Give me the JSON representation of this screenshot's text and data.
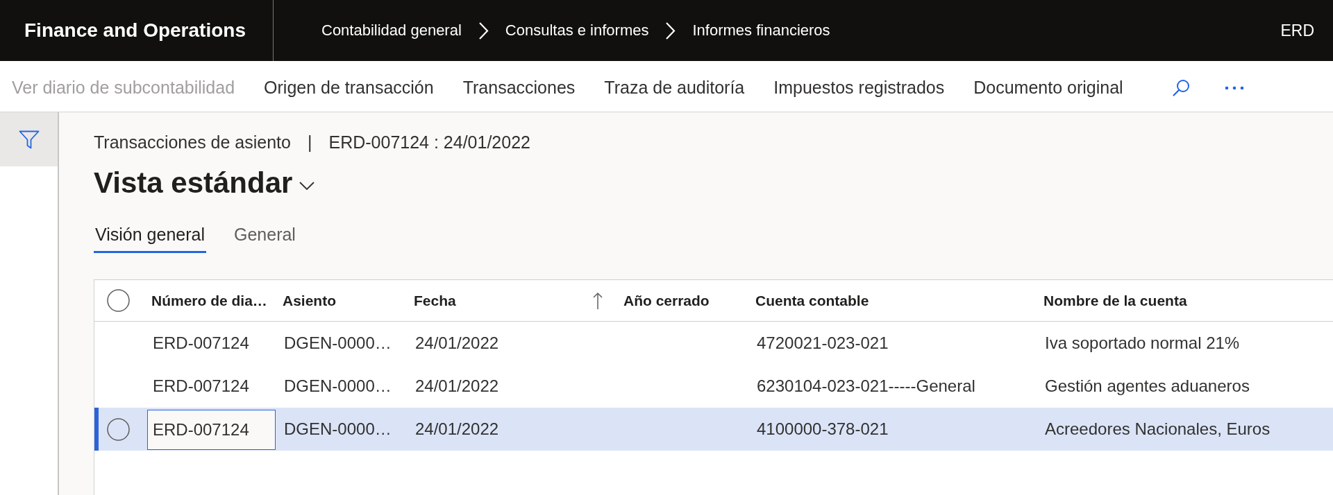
{
  "top_bar": {
    "app_title": "Finance and Operations",
    "breadcrumb": [
      "Contabilidad general",
      "Consultas e informes",
      "Informes financieros"
    ],
    "company": "ERD"
  },
  "action_bar": {
    "items": [
      {
        "label": "Ver diario de subcontabilidad",
        "disabled": true
      },
      {
        "label": "Origen de transacción",
        "disabled": false
      },
      {
        "label": "Transacciones",
        "disabled": false
      },
      {
        "label": "Traza de auditoría",
        "disabled": false
      },
      {
        "label": "Impuestos registrados",
        "disabled": false
      },
      {
        "label": "Documento original",
        "disabled": false
      }
    ]
  },
  "page": {
    "caption": "Transacciones de asiento",
    "separator": "|",
    "record": "ERD-007124 : 24/01/2022",
    "view": "Vista estándar"
  },
  "tabs": [
    {
      "label": "Visión general",
      "selected": true
    },
    {
      "label": "General",
      "selected": false
    }
  ],
  "grid": {
    "select_all": {
      "checked": false
    },
    "columns": [
      {
        "label": "Número de dia…",
        "sorted": false
      },
      {
        "label": "Asiento",
        "sorted": false
      },
      {
        "label": "Fecha",
        "sorted": true
      },
      {
        "label": "Año cerrado",
        "sorted": false
      },
      {
        "label": "Cuenta contable",
        "sorted": false
      },
      {
        "label": "Nombre de la cuenta",
        "sorted": false
      }
    ],
    "rows": [
      {
        "selected": false,
        "journal_number": "ERD-007124",
        "voucher": "DGEN-0000…",
        "date": "24/01/2022",
        "main_account": "4720021-023-021",
        "account_name": "Iva soportado normal 21%"
      },
      {
        "selected": false,
        "journal_number": "ERD-007124",
        "voucher": "DGEN-0000…",
        "date": "24/01/2022",
        "main_account": "6230104-023-021-----General",
        "account_name": "Gestión agentes aduaneros"
      },
      {
        "selected": true,
        "journal_number": "ERD-007124",
        "voucher": "DGEN-0000…",
        "date": "24/01/2022",
        "main_account": "4100000-378-021",
        "account_name": "Acreedores Nacionales, Euros"
      }
    ]
  }
}
